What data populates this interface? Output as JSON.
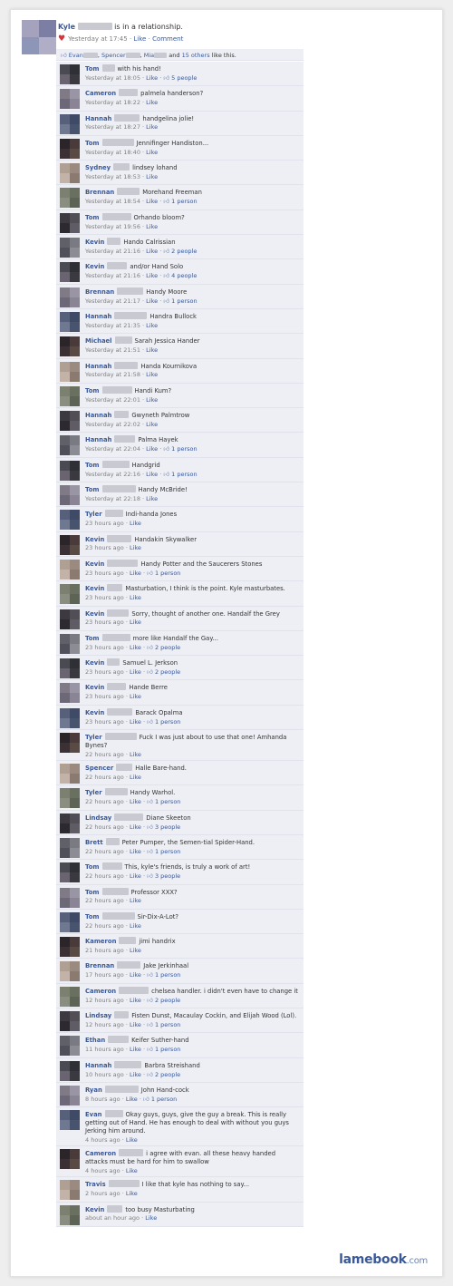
{
  "post": {
    "author": "Kyle",
    "status": "is in a relationship.",
    "timestamp": "Yesterday at 17:45",
    "like_label": "Like",
    "comment_label": "Comment"
  },
  "likes": {
    "names": [
      "Evan",
      "Spencer",
      "Mia"
    ],
    "and_text": "and",
    "others_link": "15 others",
    "suffix": "like this."
  },
  "comments": [
    {
      "name": "Tom",
      "text": "with his hand!",
      "time": "Yesterday at 18:05",
      "likes": "5 people"
    },
    {
      "name": "Cameron",
      "text": "palmela handerson?",
      "time": "Yesterday at 18:22",
      "likes": ""
    },
    {
      "name": "Hannah",
      "text": "handgelina jolie!",
      "time": "Yesterday at 18:27",
      "likes": ""
    },
    {
      "name": "Tom",
      "text": "Jennifinger Handiston...",
      "time": "Yesterday at 18:40",
      "likes": ""
    },
    {
      "name": "Sydney",
      "text": "lindsey lohand",
      "time": "Yesterday at 18:53",
      "likes": ""
    },
    {
      "name": "Brennan",
      "text": "Morehand Freeman",
      "time": "Yesterday at 18:54",
      "likes": "1 person"
    },
    {
      "name": "Tom",
      "text": "Orhando bloom?",
      "time": "Yesterday at 19:56",
      "likes": ""
    },
    {
      "name": "Kevin",
      "text": "Hando Calrissian",
      "time": "Yesterday at 21:16",
      "likes": "2 people"
    },
    {
      "name": "Kevin",
      "text": "and/or Hand Solo",
      "time": "Yesterday at 21:16",
      "likes": "4 people"
    },
    {
      "name": "Brennan",
      "text": "Handy Moore",
      "time": "Yesterday at 21:17",
      "likes": "1 person"
    },
    {
      "name": "Hannah",
      "text": "Handra Bullock",
      "time": "Yesterday at 21:35",
      "likes": ""
    },
    {
      "name": "Michael",
      "text": "Sarah Jessica Hander",
      "time": "Yesterday at 21:51",
      "likes": ""
    },
    {
      "name": "Hannah",
      "text": "Handa Kournikova",
      "time": "Yesterday at 21:58",
      "likes": ""
    },
    {
      "name": "Tom",
      "text": "Handi Kum?",
      "time": "Yesterday at 22:01",
      "likes": ""
    },
    {
      "name": "Hannah",
      "text": "Gwyneth Palmtrow",
      "time": "Yesterday at 22:02",
      "likes": ""
    },
    {
      "name": "Hannah",
      "text": "Palma Hayek",
      "time": "Yesterday at 22:04",
      "likes": "1 person"
    },
    {
      "name": "Tom",
      "text": "Handgrid",
      "time": "Yesterday at 22:16",
      "likes": "1 person"
    },
    {
      "name": "Tom",
      "text": "Handy McBride!",
      "time": "Yesterday at 22:18",
      "likes": ""
    },
    {
      "name": "Tyler",
      "text": "Indi-handa Jones",
      "time": "23 hours ago",
      "likes": ""
    },
    {
      "name": "Kevin",
      "text": "Handakin Skywalker",
      "time": "23 hours ago",
      "likes": ""
    },
    {
      "name": "Kevin",
      "text": "Handy Potter and the Saucerers Stones",
      "time": "23 hours ago",
      "likes": "1 person"
    },
    {
      "name": "Kevin",
      "text": "Masturbation, I think is the point. Kyle masturbates.",
      "time": "23 hours ago",
      "likes": ""
    },
    {
      "name": "Kevin",
      "text": "Sorry, thought of another one. Handalf the Grey",
      "time": "23 hours ago",
      "likes": ""
    },
    {
      "name": "Tom",
      "text": "more like Handalf the Gay...",
      "time": "23 hours ago",
      "likes": "2 people"
    },
    {
      "name": "Kevin",
      "text": "Samuel L. Jerkson",
      "time": "23 hours ago",
      "likes": "2 people"
    },
    {
      "name": "Kevin",
      "text": "Hande Berre",
      "time": "23 hours ago",
      "likes": ""
    },
    {
      "name": "Kevin",
      "text": "Barack Opalma",
      "time": "23 hours ago",
      "likes": "1 person"
    },
    {
      "name": "Tyler",
      "text": "Fuck I was just about to use that one! Amhanda Bynes?",
      "time": "22 hours ago",
      "likes": ""
    },
    {
      "name": "Spencer",
      "text": "Halle Bare-hand.",
      "time": "22 hours ago",
      "likes": ""
    },
    {
      "name": "Tyler",
      "text": "Handy Warhol.",
      "time": "22 hours ago",
      "likes": "1 person"
    },
    {
      "name": "Lindsay",
      "text": "Diane Skeeton",
      "time": "22 hours ago",
      "likes": "3 people"
    },
    {
      "name": "Brett",
      "text": "Peter Pumper, the Semen-tial Spider-Hand.",
      "time": "22 hours ago",
      "likes": "1 person"
    },
    {
      "name": "Tom",
      "text": "This, kyle's friends, is truly a work of art!",
      "time": "22 hours ago",
      "likes": "3 people"
    },
    {
      "name": "Tom",
      "text": "Professor XXX?",
      "time": "22 hours ago",
      "likes": ""
    },
    {
      "name": "Tom",
      "text": "Sir-Dix-A-Lot?",
      "time": "22 hours ago",
      "likes": ""
    },
    {
      "name": "Kameron",
      "text": "jimi handrix",
      "time": "21 hours ago",
      "likes": ""
    },
    {
      "name": "Brennan",
      "text": "Jake Jerkinhaal",
      "time": "17 hours ago",
      "likes": "1 person"
    },
    {
      "name": "Cameron",
      "text": "chelsea handler. i didn't even have to change it",
      "time": "12 hours ago",
      "likes": "2 people"
    },
    {
      "name": "Lindsay",
      "text": "Fisten Dunst, Macaulay Cockin, and Elijah Wood (Lol).",
      "time": "12 hours ago",
      "likes": "1 person"
    },
    {
      "name": "Ethan",
      "text": "Keifer Suther-hand",
      "time": "11 hours ago",
      "likes": "1 person"
    },
    {
      "name": "Hannah",
      "text": "Barbra Streishand",
      "time": "10 hours ago",
      "likes": "2 people"
    },
    {
      "name": "Ryan",
      "text": "John Hand-cock",
      "time": "8 hours ago",
      "likes": "1 person"
    },
    {
      "name": "Evan",
      "text": "Okay guys, guys, give the guy a break. This is really getting out of Hand. He has enough to deal with without you guys Jerking him around.",
      "time": "4 hours ago",
      "likes": ""
    },
    {
      "name": "Cameron",
      "text": "i agree with evan. all these heavy handed attacks must be hard for him to swallow",
      "time": "4 hours ago",
      "likes": ""
    },
    {
      "name": "Travis",
      "text": "I like that kyle has nothing to say...",
      "time": "2 hours ago",
      "likes": ""
    },
    {
      "name": "Kevin",
      "text": "too busy Masturbating",
      "time": "about an hour ago",
      "likes": ""
    }
  ],
  "ui": {
    "like_label": "Like",
    "sep": " · "
  },
  "watermark": {
    "brand": "lamebook",
    "tld": ".com"
  },
  "colors": {
    "link": "#3b5998",
    "comment_bg": "#edeff4",
    "meta": "#808080",
    "heart": "#d4353a"
  }
}
